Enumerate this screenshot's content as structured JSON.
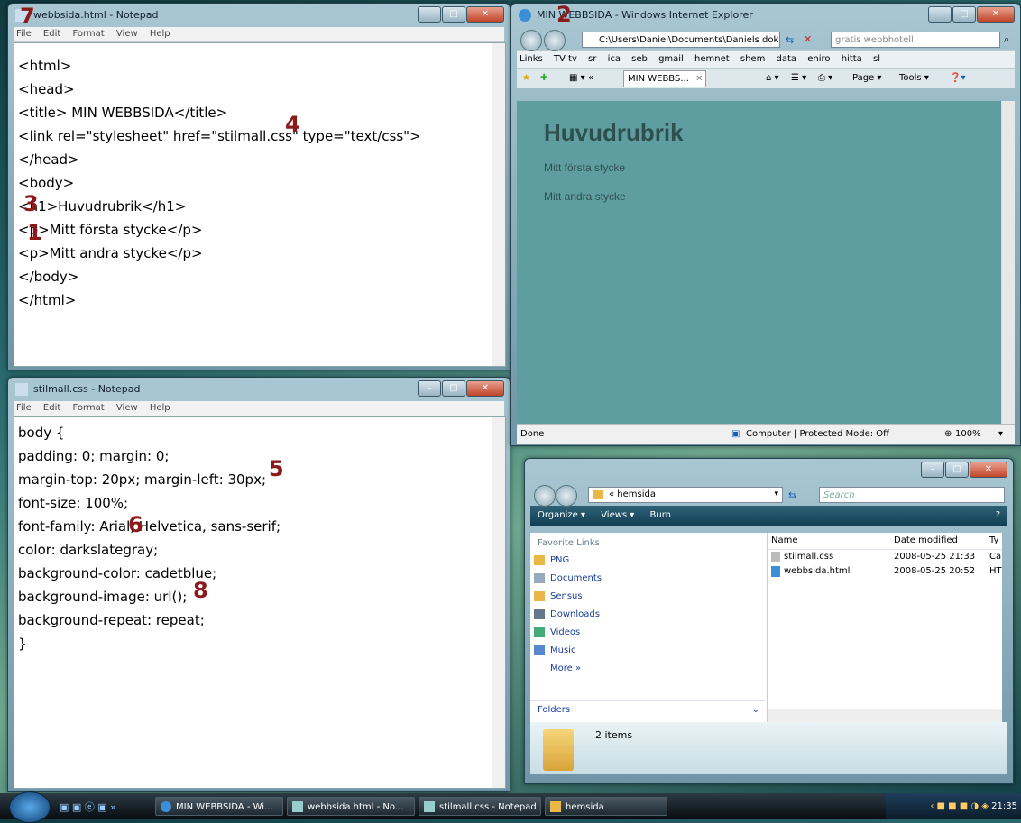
{
  "notepad_html": {
    "title": "webbsida.html - Notepad",
    "menu": [
      "File",
      "Edit",
      "Format",
      "View",
      "Help"
    ],
    "lines": [
      "<html>",
      "<head>",
      "<title> MIN WEBBSIDA</title>",
      "<link rel=\"stylesheet\" href=\"stilmall.css\" type=\"text/css\">",
      "</head>",
      "<body>",
      "<h1>Huvudrubrik</h1>",
      "<p>Mitt första stycke</p>",
      "<p>Mitt andra stycke</p>",
      "</body>",
      "</html>"
    ]
  },
  "notepad_css": {
    "title": "stilmall.css - Notepad",
    "menu": [
      "File",
      "Edit",
      "Format",
      "View",
      "Help"
    ],
    "lines": [
      "body {",
      "padding: 0; margin: 0;",
      "margin-top: 20px; margin-left: 30px;",
      "font-size: 100%;",
      "font-family: Arial, Helvetica, sans-serif;",
      "color: darkslategray;",
      "background-color: cadetblue;",
      "background-image: url();",
      "background-repeat: repeat;",
      "}"
    ]
  },
  "ie": {
    "title": "MIN WEBBSIDA - Windows Internet Explorer",
    "address": "C:\\Users\\Daniel\\Documents\\Daniels dok",
    "search_placeholder": "gratis webbhotell",
    "links": [
      "Links",
      "TV tv",
      "sr",
      "ica",
      "seb",
      "gmail",
      "hemnet",
      "shem",
      "data",
      "eniro",
      "hitta",
      "sl"
    ],
    "tab_label": "MIN WEBBS...",
    "tools": [
      "Page ▾",
      "Tools ▾"
    ],
    "page_h1": "Huvudrubrik",
    "page_p1": "Mitt första stycke",
    "page_p2": "Mitt andra stycke",
    "status_left": "Done",
    "status_zone": "Computer | Protected Mode: Off",
    "zoom": "100%",
    "page_bg": "#5f9ea0",
    "page_text": "#2f4f4f"
  },
  "explorer": {
    "breadcrumb": "« hemsida",
    "search_placeholder": "Search",
    "commands": [
      "Organize ▾",
      "Views ▾",
      "Burn"
    ],
    "favorites_header": "Favorite Links",
    "favorites": [
      "PNG",
      "Documents",
      "Sensus",
      "Downloads",
      "Videos",
      "Music"
    ],
    "more": "More »",
    "folders": "Folders",
    "columns": [
      "Name",
      "Date modified",
      "Ty"
    ],
    "files": [
      {
        "name": "stilmall.css",
        "date": "2008-05-25 21:33",
        "type": "Ca"
      },
      {
        "name": "webbsida.html",
        "date": "2008-05-25 20:52",
        "type": "HT"
      }
    ],
    "item_count": "2 items"
  },
  "annotations": [
    "1",
    "2",
    "3",
    "4",
    "5",
    "6",
    "7",
    "8"
  ],
  "taskbar": {
    "items": [
      "MIN WEBBSIDA - Wi...",
      "webbsida.html - No...",
      "stilmall.css - Notepad",
      "hemsida"
    ],
    "clock": "21:35"
  }
}
